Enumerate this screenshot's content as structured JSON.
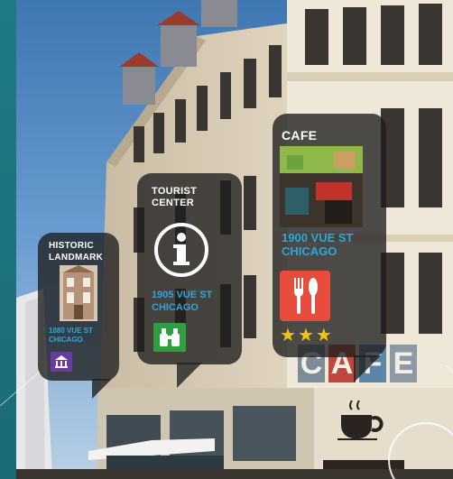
{
  "bubbles": {
    "historic": {
      "title": "HISTORIC\nLANDMARK",
      "address": "1880 VUE ST\nCHICAGO",
      "icon": "landmark-icon"
    },
    "tourist": {
      "title": "TOURIST\nCENTER",
      "address": "1905 VUE ST\nCHICAGO",
      "icon": "information-icon",
      "badge_icon": "binoculars-icon"
    },
    "cafe": {
      "title": "CAFE",
      "address": "1900 VUE ST\nCHICAGO",
      "icon": "fork-knife-icon",
      "rating": 3,
      "rating_max": 3
    }
  },
  "storefront": {
    "sign_letters": [
      "C",
      "A",
      "F",
      "E"
    ],
    "cup_icon": "coffee-cup-icon"
  },
  "colors": {
    "frame": "#1e6f7c",
    "bubble_bg": "#1e1e1e",
    "address": "#2da7d9",
    "cafe_icon_bg": "#e74c3c",
    "tourist_badge_bg": "#2e9e3e",
    "historic_badge_bg": "#6a3aa0",
    "star": "#f1c40f"
  }
}
